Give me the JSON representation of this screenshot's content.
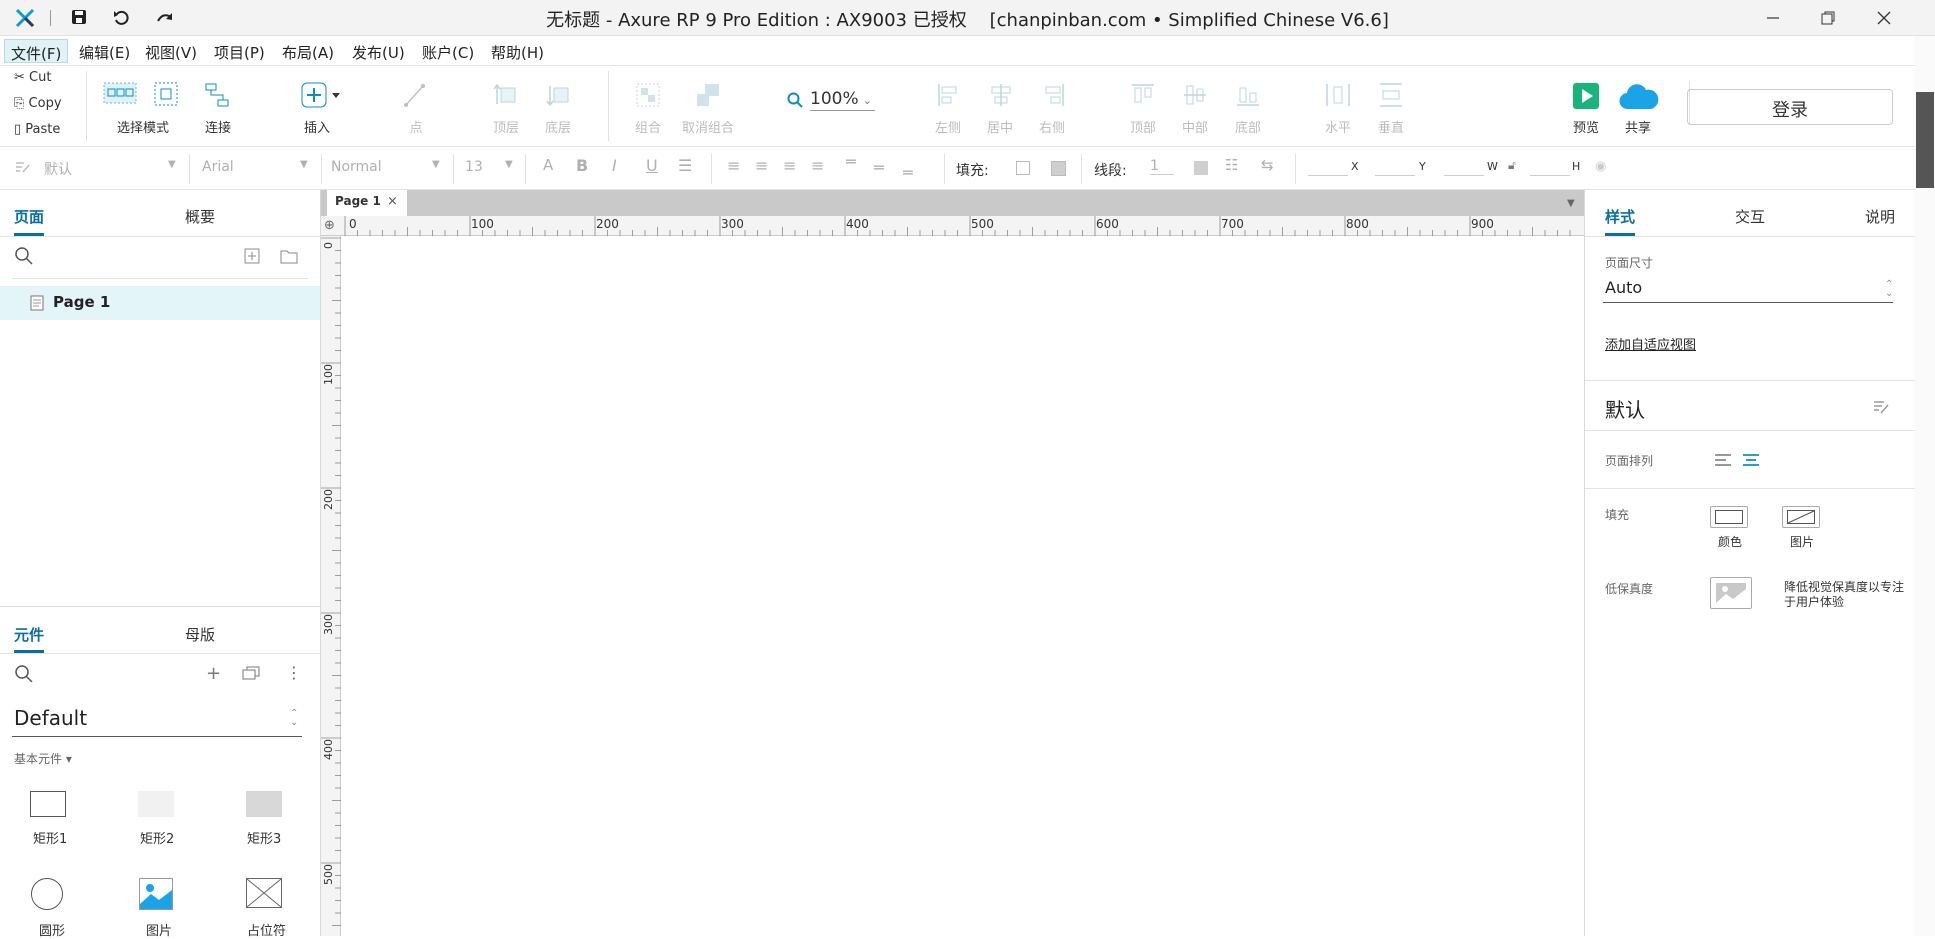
{
  "title": "无标题 - Axure RP 9 Pro Edition : AX9003 已授权    [chanpinban.com • Simplified Chinese V6.6]",
  "menu": [
    "文件(F)",
    "编辑(E)",
    "视图(V)",
    "项目(P)",
    "布局(A)",
    "发布(U)",
    "账户(C)",
    "帮助(H)"
  ],
  "clipboard": {
    "cut": "Cut",
    "copy": "Copy",
    "paste": "Paste"
  },
  "toolbar": {
    "select_mode": "选择模式",
    "connect": "连接",
    "insert": "插入",
    "point": "点",
    "top_layer": "顶层",
    "bottom_layer": "底层",
    "group": "组合",
    "ungroup": "取消组合",
    "zoom": "100%",
    "left": "左侧",
    "center": "居中",
    "right": "右侧",
    "top": "顶部",
    "middle": "中部",
    "bottom": "底部",
    "horizontal": "水平",
    "vertical": "垂直",
    "preview": "预览",
    "share": "共享",
    "login": "登录"
  },
  "format": {
    "style": "默认",
    "font": "Arial",
    "weight": "Normal",
    "size": "13",
    "fill_label": "填充:",
    "stroke_label": "线段:",
    "stroke_value": "1",
    "x": "X",
    "y": "Y",
    "w": "W",
    "h": "H"
  },
  "left": {
    "tab_pages": "页面",
    "tab_outline": "概要",
    "page_item": "Page 1",
    "tab_widgets": "元件",
    "tab_masters": "母版",
    "library": "Default",
    "category": "基本元件 ▾",
    "widgets": [
      {
        "label": "矩形1"
      },
      {
        "label": "矩形2"
      },
      {
        "label": "矩形3"
      },
      {
        "label": "圆形"
      },
      {
        "label": "图片"
      },
      {
        "label": "占位符"
      }
    ]
  },
  "canvas": {
    "tab": "Page 1",
    "ruler_h": [
      "0",
      "100",
      "200",
      "300",
      "400",
      "500",
      "600",
      "700",
      "800",
      "900"
    ],
    "ruler_v": [
      "0",
      "100",
      "200",
      "300",
      "400",
      "500"
    ]
  },
  "right": {
    "tab_style": "样式",
    "tab_interact": "交互",
    "tab_notes": "说明",
    "page_size_label": "页面尺寸",
    "page_size_value": "Auto",
    "add_adaptive": "添加自适应视图",
    "default_label": "默认",
    "page_align": "页面排列",
    "fill_label": "填充",
    "fill_color": "颜色",
    "fill_image": "图片",
    "lowfi_label": "低保真度",
    "lowfi_desc": "降低视觉保真度以专注于用户体验"
  }
}
